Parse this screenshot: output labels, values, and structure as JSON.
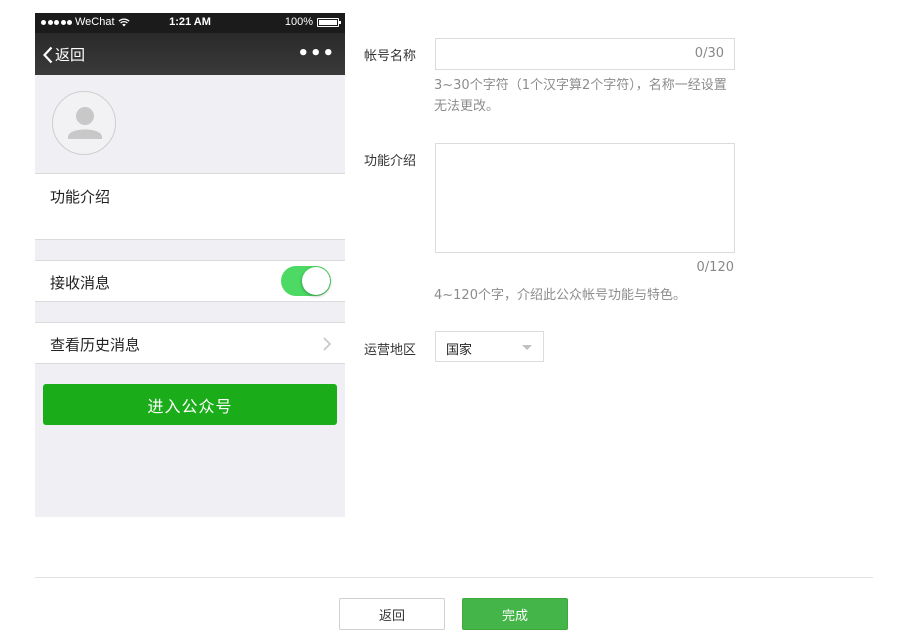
{
  "preview": {
    "status_bar": {
      "carrier": "WeChat",
      "time": "1:21 AM",
      "battery": "100%"
    },
    "nav": {
      "back_label": "返回",
      "more_label": "•••"
    },
    "intro_label": "功能介绍",
    "receive_label": "接收消息",
    "receive_enabled": true,
    "history_label": "查看历史消息",
    "enter_button": "进入公众号"
  },
  "form": {
    "name_label": "帐号名称",
    "name_value": "",
    "name_counter": "0/30",
    "name_hint": "3~30个字符（1个汉字算2个字符），名称一经设置无法更改。",
    "intro_label": "功能介绍",
    "intro_value": "",
    "intro_counter": "0/120",
    "intro_hint": "4~120个字，介绍此公众帐号功能与特色。",
    "region_label": "运营地区",
    "region_selected": "国家"
  },
  "footer": {
    "back_button": "返回",
    "done_button": "完成"
  },
  "colors": {
    "enter_button_green": "#1aad19",
    "toggle_on_green": "#4cd964",
    "done_button_green": "#44b549"
  }
}
